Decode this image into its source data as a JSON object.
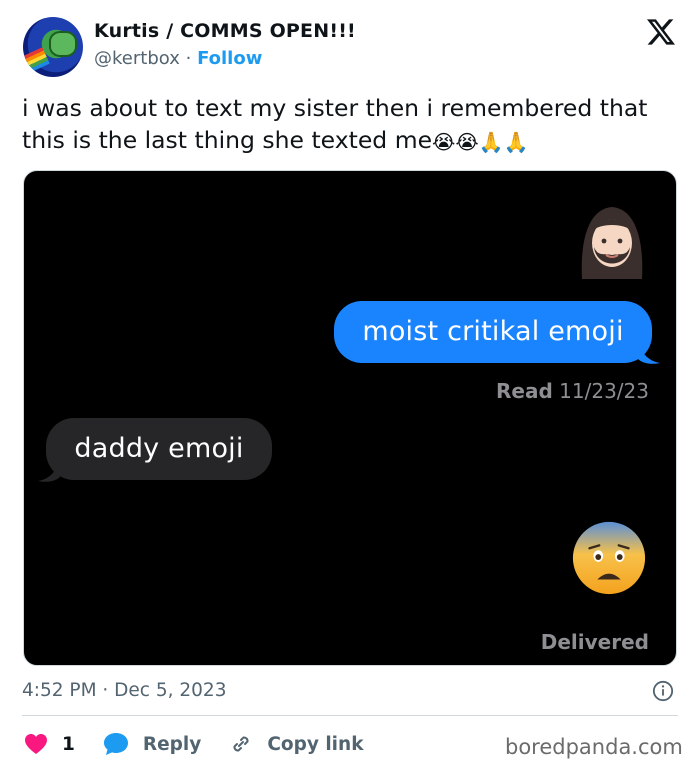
{
  "author": {
    "name": "Kurtis / COMMS OPEN!!!",
    "handle": "@kertbox",
    "separator": "·",
    "follow_label": "Follow"
  },
  "tweet": {
    "text": "i was about to text my sister then i remembered that this is the last thing she texted me",
    "trailing_emojis": [
      "😭",
      "😭",
      "🙏",
      "🙏"
    ]
  },
  "screenshot": {
    "contact_emoji": "bearded-woman-emoji",
    "sent_message": "moist critikal emoji",
    "read_status_label": "Read",
    "read_status_date": "11/23/23",
    "received_message": "daddy emoji",
    "reply_emoji": "fearful-face-emoji",
    "delivered_label": "Delivered"
  },
  "meta": {
    "timestamp": "4:52 PM · Dec 5, 2023"
  },
  "actions": {
    "like_count": "1",
    "reply_label": "Reply",
    "copy_link_label": "Copy link"
  },
  "watermark": "boredpanda.com",
  "colors": {
    "imessage_blue": "#1a84ff",
    "imessage_gray": "#262628",
    "follow_blue": "#1d9bf0",
    "like_pink": "#f91880"
  }
}
